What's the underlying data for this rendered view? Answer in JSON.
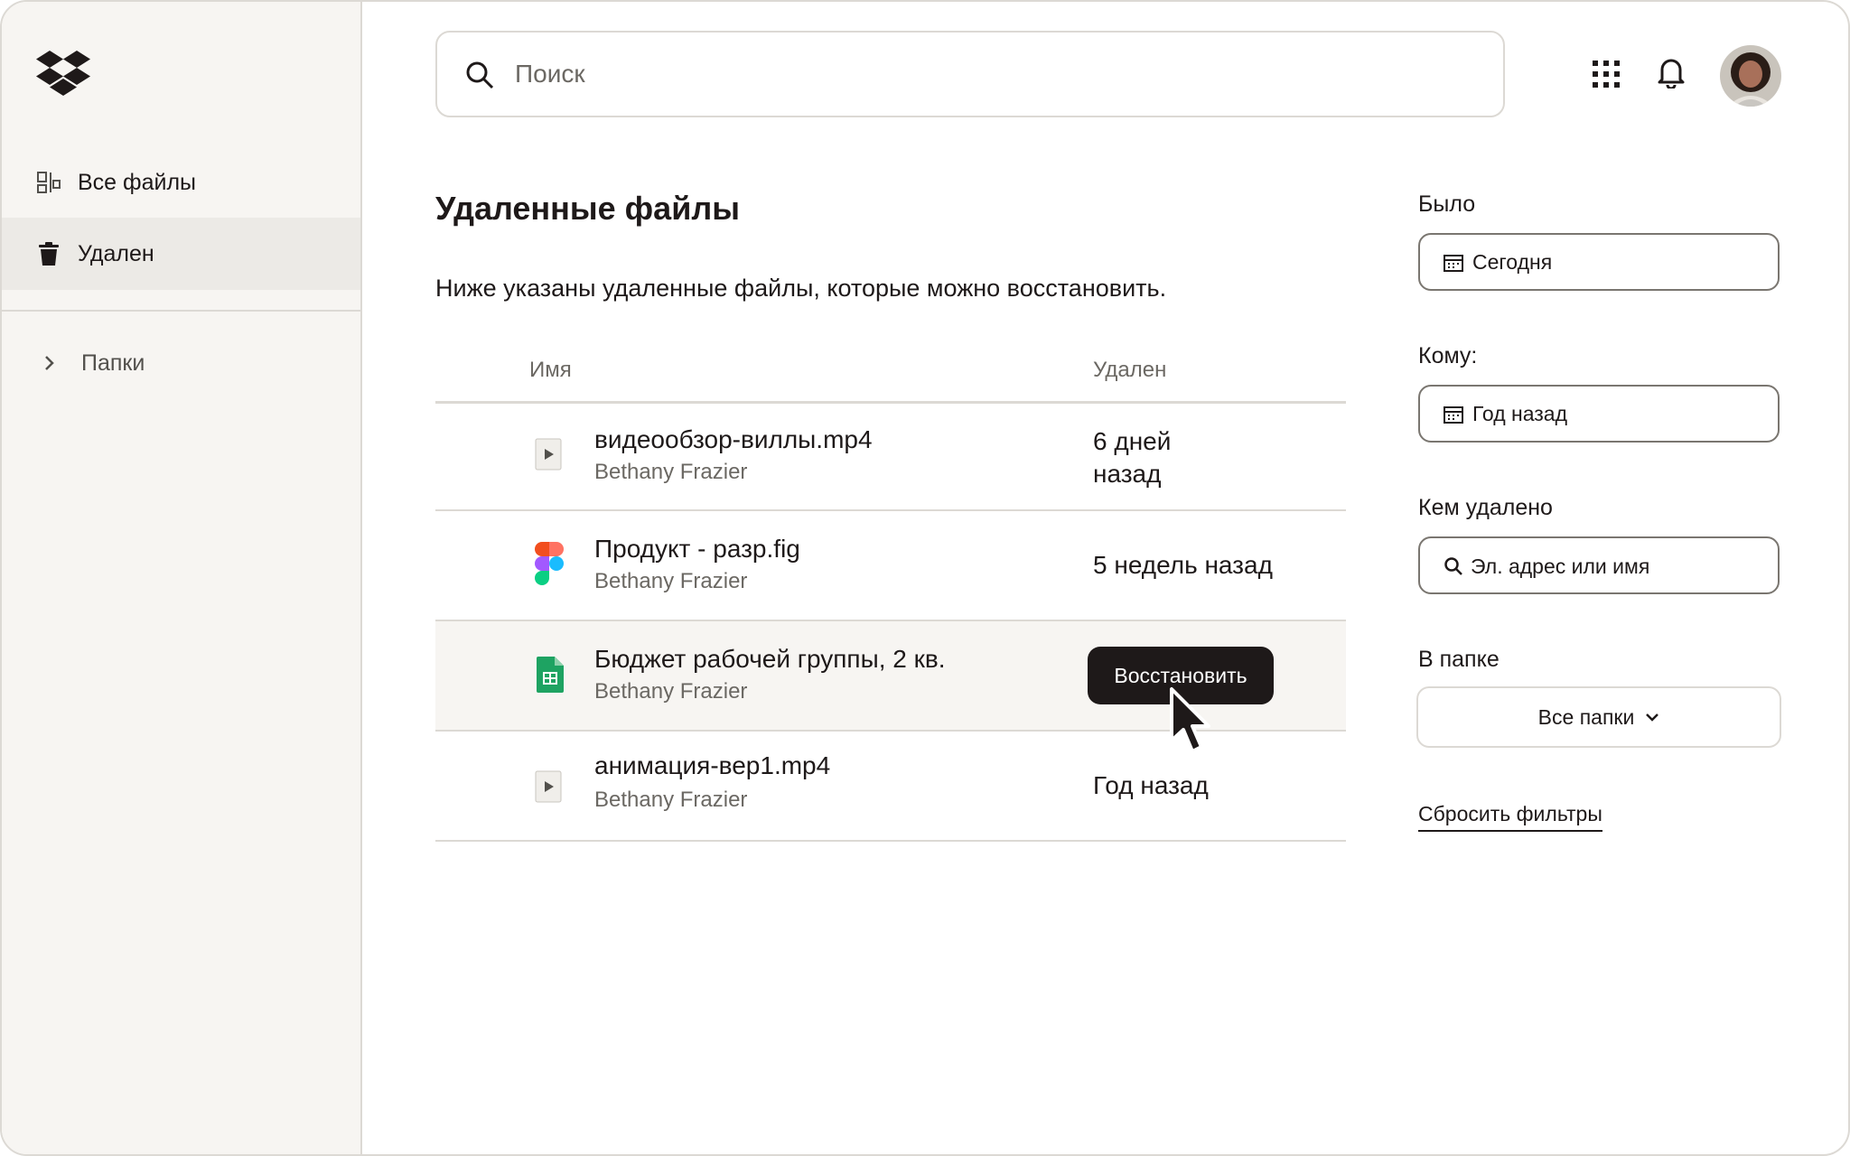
{
  "sidebar": {
    "items": [
      {
        "label": "Все файлы",
        "icon": "all-files-icon"
      },
      {
        "label": "Удален",
        "icon": "trash-icon",
        "active": true
      },
      {
        "label": "Папки",
        "icon": "chevron-right-icon"
      }
    ]
  },
  "search": {
    "placeholder": "Поиск"
  },
  "main": {
    "title": "Удаленные файлы",
    "description": "Ниже указаны удаленные файлы, которые можно восстановить.",
    "columns": {
      "name": "Имя",
      "deleted": "Удален"
    },
    "files": [
      {
        "name": "видеообзор-виллы.mp4",
        "owner": "Bethany Frazier",
        "deleted_line1": "6 дней",
        "deleted_line2": "назад",
        "icon": "video-file-icon"
      },
      {
        "name": "Продукт - разр.fig",
        "owner": "Bethany Frazier",
        "deleted": "5 недель назад",
        "icon": "figma-file-icon"
      },
      {
        "name": "Бюджет рабочей группы, 2 кв.",
        "owner": "Bethany Frazier",
        "action": "Восстановить",
        "icon": "spreadsheet-file-icon"
      },
      {
        "name": "анимация-вер1.mp4",
        "owner": "Bethany Frazier",
        "deleted": "Год назад",
        "icon": "video-file-icon"
      }
    ]
  },
  "filters": {
    "from_label": "Было",
    "from_value": "Сегодня",
    "to_label": "Кому:",
    "to_value": "Год назад",
    "deleted_by_label": "Кем удалено",
    "deleted_by_placeholder": "Эл. адрес или имя",
    "folder_label": "В папке",
    "folder_value": "Все папки",
    "reset": "Сбросить фильтры"
  },
  "colors": {
    "sidebar_bg": "#f7f5f2",
    "active_bg": "#eceae6",
    "text": "#1e1919",
    "muted": "#6b6863",
    "button_bg": "#1e1919"
  }
}
